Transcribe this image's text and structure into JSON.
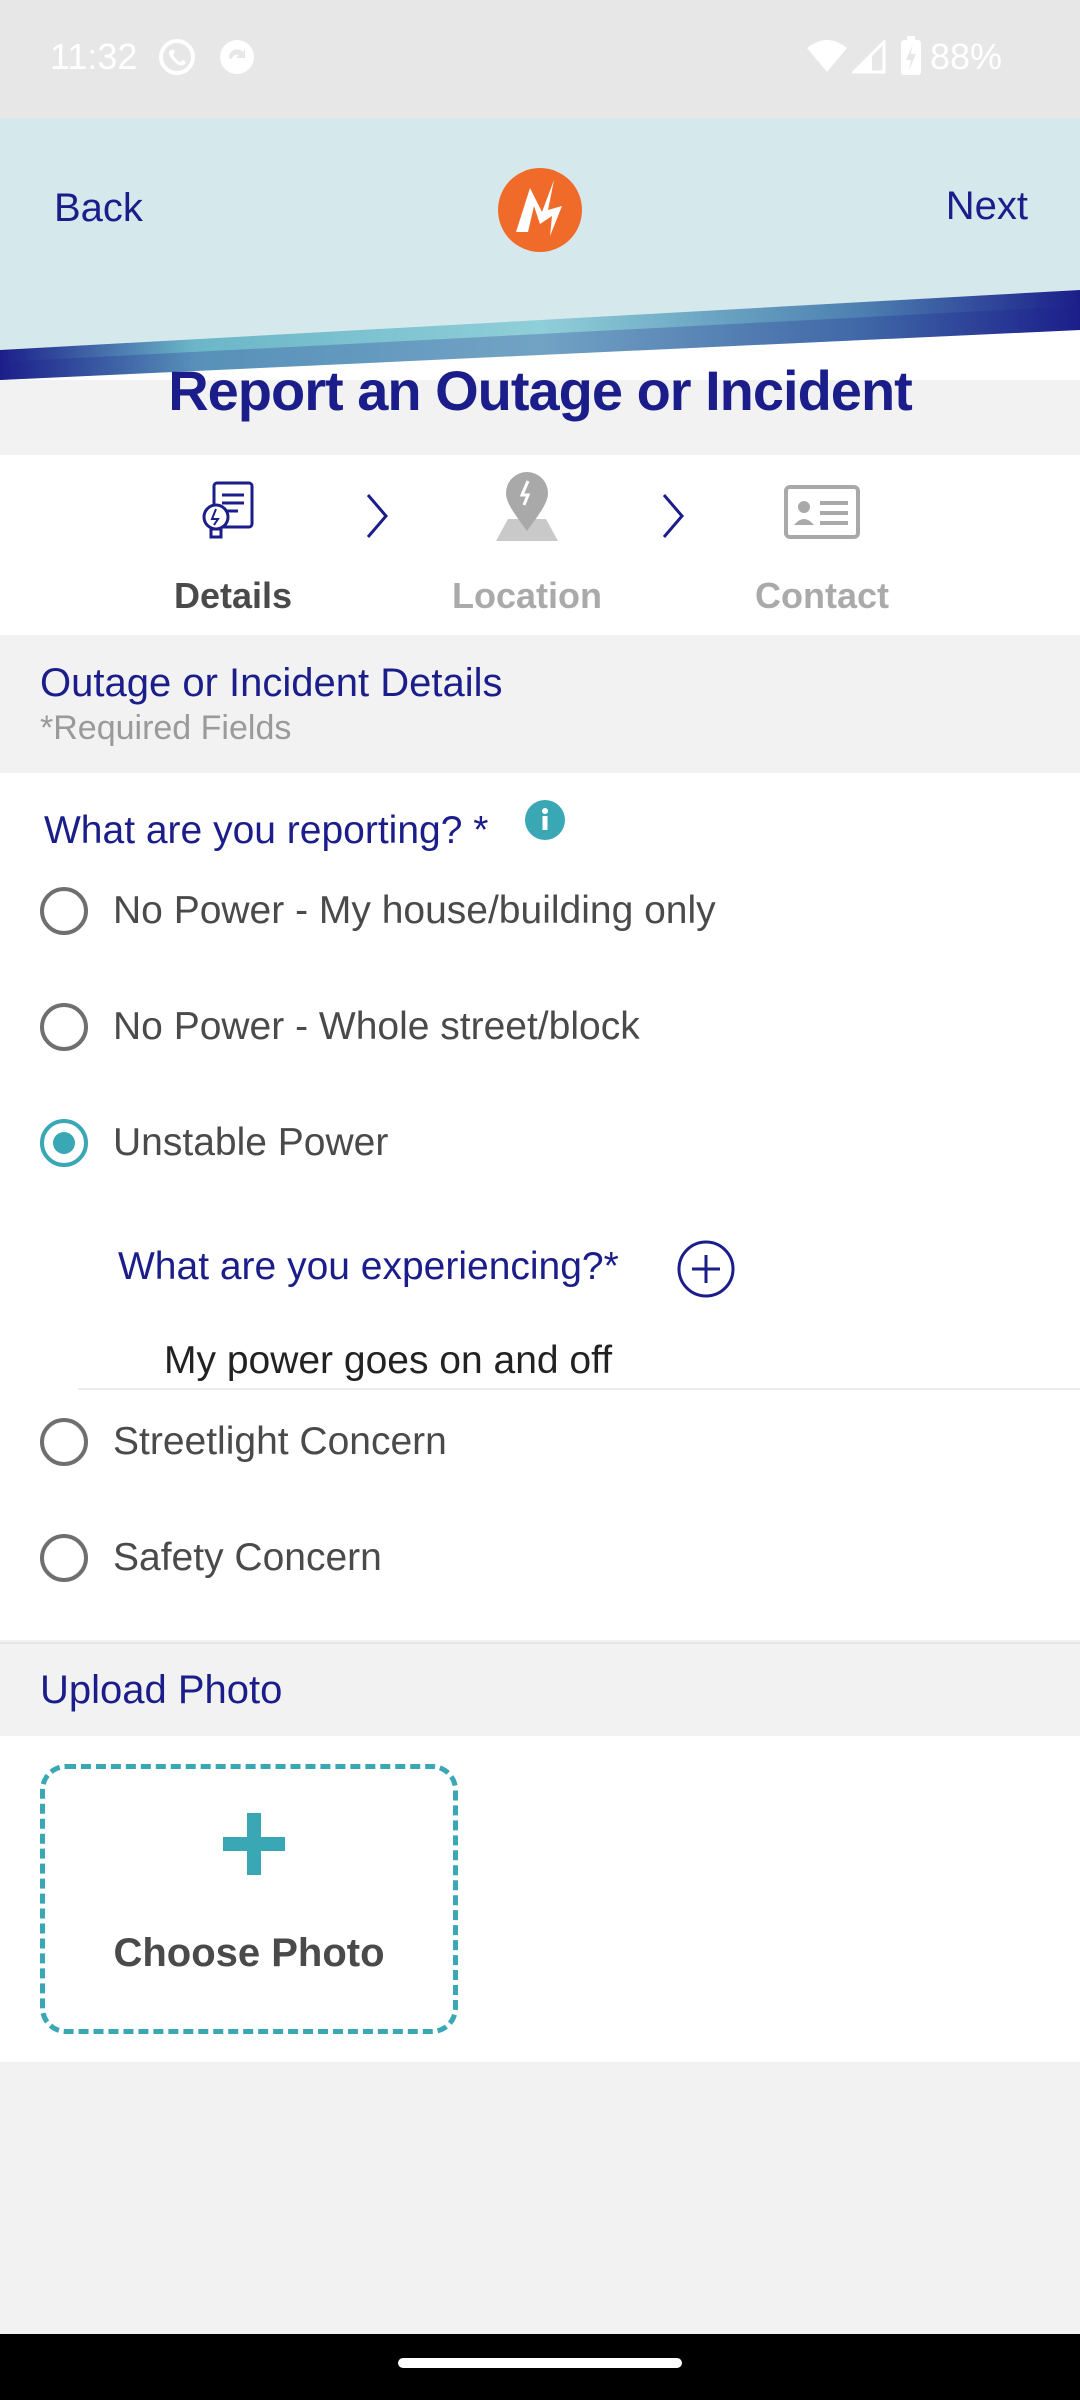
{
  "status_bar": {
    "time": "11:32",
    "battery": "88%"
  },
  "header": {
    "back_label": "Back",
    "next_label": "Next",
    "title": "Report an Outage or Incident"
  },
  "steps": [
    {
      "label": "Details",
      "icon": "document-bulb-icon",
      "active": true
    },
    {
      "label": "Location",
      "icon": "map-pin-icon",
      "active": false
    },
    {
      "label": "Contact",
      "icon": "contact-card-icon",
      "active": false
    }
  ],
  "details_section": {
    "title": "Outage or Incident Details",
    "required_note": "*Required Fields"
  },
  "reporting": {
    "question": "What are you reporting? *",
    "options": [
      {
        "label": "No Power - My house/building only",
        "selected": false
      },
      {
        "label": "No Power - Whole street/block",
        "selected": false
      },
      {
        "label": "Unstable Power",
        "selected": true
      },
      {
        "label": "Streetlight Concern",
        "selected": false
      },
      {
        "label": "Safety Concern",
        "selected": false
      }
    ]
  },
  "experiencing": {
    "question": "What are you experiencing?*",
    "value": "My power goes on and off"
  },
  "upload": {
    "title": "Upload Photo",
    "button_label": "Choose Photo"
  },
  "colors": {
    "brand_blue": "#1b1e8a",
    "accent_teal": "#3aa7b5",
    "logo_orange": "#f06b2a",
    "header_bg": "#d5e8ec"
  }
}
